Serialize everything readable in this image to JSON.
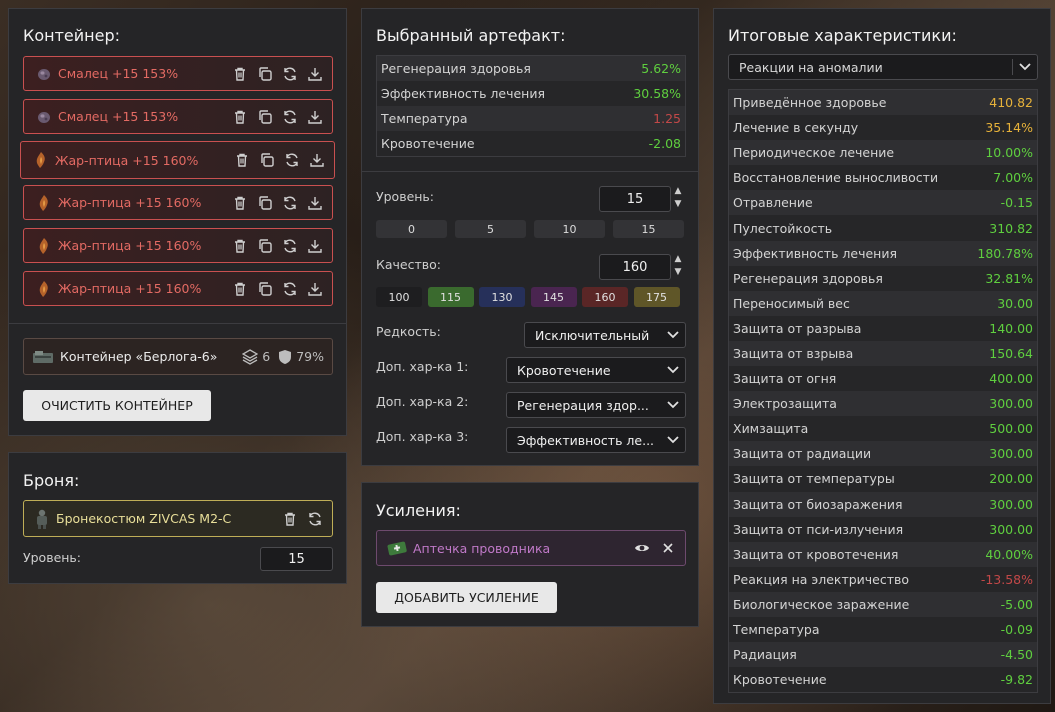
{
  "container": {
    "title": "Контейнер:",
    "artifacts": [
      {
        "label": "Смалец +15 153%",
        "icon": "smalets-icon"
      },
      {
        "label": "Смалец +15 153%",
        "icon": "smalets-icon"
      },
      {
        "label": "Жар-птица +15 160%",
        "icon": "zhar-ptitsa-icon"
      },
      {
        "label": "Жар-птица +15 160%",
        "icon": "zhar-ptitsa-icon"
      },
      {
        "label": "Жар-птица +15 160%",
        "icon": "zhar-ptitsa-icon"
      },
      {
        "label": "Жар-птица +15 160%",
        "icon": "zhar-ptitsa-icon"
      }
    ],
    "card": {
      "name": "Контейнер «Берлога-6»",
      "slots": "6",
      "protection": "79%"
    },
    "clear_label": "ОЧИСТИТЬ КОНТЕЙНЕР"
  },
  "armor": {
    "title": "Броня:",
    "name": "Бронекостюм ZIVCAS M2-C",
    "level_label": "Уровень:",
    "level_value": "15"
  },
  "artifact": {
    "title": "Выбранный артефакт:",
    "stats": [
      {
        "name": "Регенерация здоровья",
        "value": "5.62%",
        "color": "green"
      },
      {
        "name": "Эффективность лечения",
        "value": "30.58%",
        "color": "green"
      },
      {
        "name": "Температура",
        "value": "1.25",
        "color": "red"
      },
      {
        "name": "Кровотечение",
        "value": "-2.08",
        "color": "green"
      }
    ],
    "level_label": "Уровень:",
    "level_value": "15",
    "level_presets": [
      "0",
      "5",
      "10",
      "15"
    ],
    "quality_label": "Качество:",
    "quality_value": "160",
    "quality_presets": [
      {
        "label": "100",
        "color": "#1e1e20"
      },
      {
        "label": "115",
        "color": "#3a6a2e"
      },
      {
        "label": "130",
        "color": "#26305a"
      },
      {
        "label": "145",
        "color": "#4a2550"
      },
      {
        "label": "160",
        "color": "#5a2626"
      },
      {
        "label": "175",
        "color": "#5f5628"
      }
    ],
    "rarity_label": "Редкость:",
    "rarity_value": "Исключительный",
    "extra": [
      {
        "label": "Доп. хар-ка 1:",
        "value": "Кровотечение"
      },
      {
        "label": "Доп. хар-ка 2:",
        "value": "Регенерация здор..."
      },
      {
        "label": "Доп. хар-ка 3:",
        "value": "Эффективность ле..."
      }
    ]
  },
  "boosts": {
    "title": "Усиления:",
    "item": "Аптечка проводника",
    "add_label": "ДОБАВИТЬ УСИЛЕНИЕ"
  },
  "total": {
    "title": "Итоговые характеристики:",
    "select_value": "Реакции на аномалии",
    "stats": [
      {
        "name": "Приведённое здоровье",
        "value": "410.82",
        "color": "yellow"
      },
      {
        "name": "Лечение в секунду",
        "value": "35.14%",
        "color": "yellow"
      },
      {
        "name": "Периодическое лечение",
        "value": "10.00%",
        "color": "green"
      },
      {
        "name": "Восстановление выносливости",
        "value": "7.00%",
        "color": "green"
      },
      {
        "name": "Отравление",
        "value": "-0.15",
        "color": "green"
      },
      {
        "name": "Пулестойкость",
        "value": "310.82",
        "color": "green"
      },
      {
        "name": "Эффективность лечения",
        "value": "180.78%",
        "color": "green"
      },
      {
        "name": "Регенерация здоровья",
        "value": "32.81%",
        "color": "green"
      },
      {
        "name": "Переносимый вес",
        "value": "30.00",
        "color": "green"
      },
      {
        "name": "Защита от разрыва",
        "value": "140.00",
        "color": "green"
      },
      {
        "name": "Защита от взрыва",
        "value": "150.64",
        "color": "green"
      },
      {
        "name": "Защита от огня",
        "value": "400.00",
        "color": "green"
      },
      {
        "name": "Электрозащита",
        "value": "300.00",
        "color": "green"
      },
      {
        "name": "Химзащита",
        "value": "500.00",
        "color": "green"
      },
      {
        "name": "Защита от радиации",
        "value": "300.00",
        "color": "green"
      },
      {
        "name": "Защита от температуры",
        "value": "200.00",
        "color": "green"
      },
      {
        "name": "Защита от биозаражения",
        "value": "300.00",
        "color": "green"
      },
      {
        "name": "Защита от пси-излучения",
        "value": "300.00",
        "color": "green"
      },
      {
        "name": "Защита от кровотечения",
        "value": "40.00%",
        "color": "green"
      },
      {
        "name": "Реакция на электричество",
        "value": "-13.58%",
        "color": "red"
      },
      {
        "name": "Биологическое заражение",
        "value": "-5.00",
        "color": "green"
      },
      {
        "name": "Температура",
        "value": "-0.09",
        "color": "green"
      },
      {
        "name": "Радиация",
        "value": "-4.50",
        "color": "green"
      },
      {
        "name": "Кровотечение",
        "value": "-9.82",
        "color": "green"
      }
    ]
  }
}
